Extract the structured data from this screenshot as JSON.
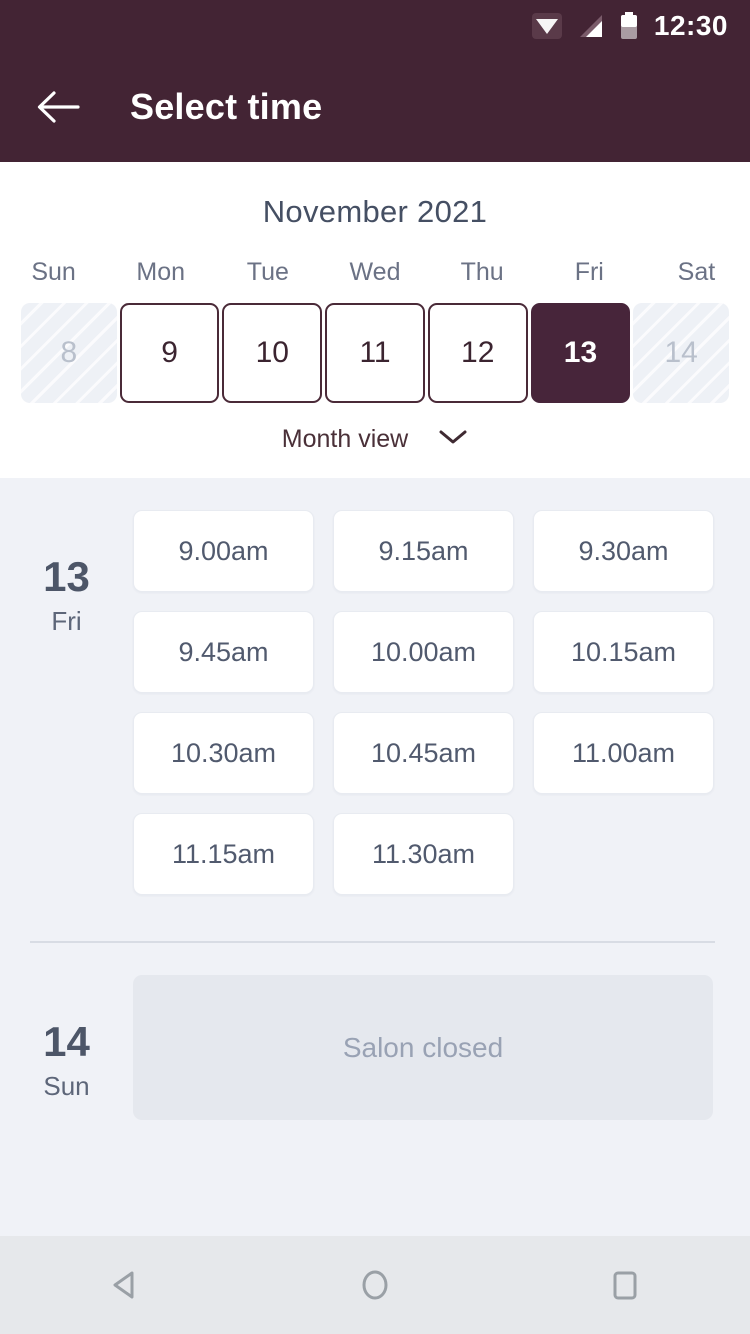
{
  "theme": {
    "header_bg": "#432434",
    "accent": "#47253a",
    "page_bg": "#f0f2f7",
    "slot_text": "#515a6e",
    "muted": "#99a2b4"
  },
  "status_bar": {
    "time": "12:30",
    "icons": [
      "wifi-icon",
      "cellular-signal-icon",
      "battery-icon"
    ]
  },
  "app_bar": {
    "back_icon": "arrow-left-icon",
    "title": "Select time"
  },
  "calendar": {
    "month_title": "November 2021",
    "day_headers": [
      "Sun",
      "Mon",
      "Tue",
      "Wed",
      "Thu",
      "Fri",
      "Sat"
    ],
    "days": [
      {
        "label": "8",
        "state": "disabled"
      },
      {
        "label": "9",
        "state": "enabled"
      },
      {
        "label": "10",
        "state": "enabled"
      },
      {
        "label": "11",
        "state": "enabled"
      },
      {
        "label": "12",
        "state": "enabled"
      },
      {
        "label": "13",
        "state": "selected"
      },
      {
        "label": "14",
        "state": "disabled"
      }
    ],
    "view_toggle": {
      "label": "Month view",
      "icon": "chevron-down-icon"
    }
  },
  "schedule": [
    {
      "day_number": "13",
      "day_name": "Fri",
      "slots": [
        "9.00am",
        "9.15am",
        "9.30am",
        "9.45am",
        "10.00am",
        "10.15am",
        "10.30am",
        "10.45am",
        "11.00am",
        "11.15am",
        "11.30am"
      ]
    },
    {
      "day_number": "14",
      "day_name": "Sun",
      "closed_message": "Salon closed"
    }
  ],
  "nav_bar": {
    "back": "nav-back-icon",
    "home": "nav-home-icon",
    "recents": "nav-recents-icon"
  }
}
